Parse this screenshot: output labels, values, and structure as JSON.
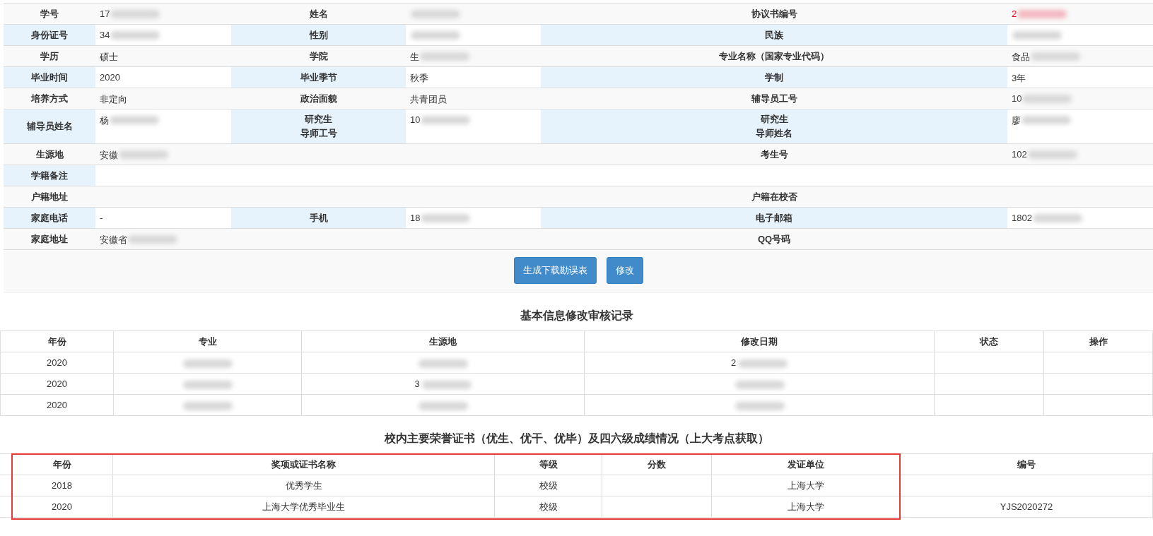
{
  "info_rows": [
    {
      "cells": [
        {
          "kind": "label",
          "text": "学号"
        },
        {
          "kind": "value",
          "text": "17",
          "blurred": true
        },
        {
          "kind": "label",
          "text": "姓名"
        },
        {
          "kind": "value",
          "blurred": true
        },
        {
          "kind": "label",
          "text": "协议书编号"
        },
        {
          "kind": "value",
          "text": "2",
          "blurred": true,
          "warning": true
        }
      ]
    },
    {
      "cells": [
        {
          "kind": "label",
          "text": "身份证号"
        },
        {
          "kind": "value",
          "text": "34",
          "blurred": true
        },
        {
          "kind": "label",
          "text": "性别"
        },
        {
          "kind": "value",
          "blurred": true
        },
        {
          "kind": "label",
          "text": "民族"
        },
        {
          "kind": "value",
          "blurred": true
        }
      ]
    },
    {
      "cells": [
        {
          "kind": "label",
          "text": "学历"
        },
        {
          "kind": "value",
          "text": "硕士"
        },
        {
          "kind": "label",
          "text": "学院"
        },
        {
          "kind": "value",
          "text": "生",
          "blurred": true
        },
        {
          "kind": "label",
          "text": "专业名称（国家专业代码）"
        },
        {
          "kind": "value",
          "text": "食品",
          "blurred": true
        }
      ]
    },
    {
      "cells": [
        {
          "kind": "label",
          "text": "毕业时间"
        },
        {
          "kind": "value",
          "text": "2020"
        },
        {
          "kind": "label",
          "text": "毕业季节"
        },
        {
          "kind": "value",
          "text": "秋季"
        },
        {
          "kind": "label",
          "text": "学制"
        },
        {
          "kind": "value",
          "text": "3年"
        }
      ]
    },
    {
      "cells": [
        {
          "kind": "label",
          "text": "培养方式"
        },
        {
          "kind": "value",
          "text": "非定向"
        },
        {
          "kind": "label",
          "text": "政治面貌"
        },
        {
          "kind": "value",
          "text": "共青团员"
        },
        {
          "kind": "label",
          "text": "辅导员工号"
        },
        {
          "kind": "value",
          "text": "10",
          "blurred": true
        }
      ]
    },
    {
      "cells": [
        {
          "kind": "label",
          "text": "辅导员姓名"
        },
        {
          "kind": "value",
          "text": "杨",
          "blurred": true
        },
        {
          "kind": "label",
          "lines": [
            "研究生",
            "导师工号"
          ]
        },
        {
          "kind": "value",
          "text": "10",
          "blurred": true
        },
        {
          "kind": "label",
          "lines": [
            "研究生",
            "导师姓名"
          ]
        },
        {
          "kind": "value",
          "text": "廖",
          "blurred": true
        }
      ]
    },
    {
      "cells": [
        {
          "kind": "label",
          "text": "生源地"
        },
        {
          "kind": "value",
          "text": "安徽",
          "blurred": true
        },
        {
          "kind": "blank"
        },
        {
          "kind": "blank"
        },
        {
          "kind": "label",
          "text": "考生号"
        },
        {
          "kind": "value",
          "text": "102",
          "blurred": true
        }
      ]
    },
    {
      "cells": [
        {
          "kind": "label",
          "text": "学籍备注"
        },
        {
          "kind": "blank"
        },
        {
          "kind": "blank"
        },
        {
          "kind": "blank"
        },
        {
          "kind": "blank"
        },
        {
          "kind": "blank"
        }
      ]
    },
    {
      "cells": [
        {
          "kind": "label",
          "text": "户籍地址"
        },
        {
          "kind": "blank"
        },
        {
          "kind": "blank"
        },
        {
          "kind": "blank"
        },
        {
          "kind": "label",
          "text": "户籍在校否"
        },
        {
          "kind": "blank"
        }
      ]
    },
    {
      "cells": [
        {
          "kind": "label",
          "text": "家庭电话"
        },
        {
          "kind": "value",
          "text": "-"
        },
        {
          "kind": "label",
          "text": "手机"
        },
        {
          "kind": "value",
          "text": "18",
          "blurred": true
        },
        {
          "kind": "label",
          "text": "电子邮箱"
        },
        {
          "kind": "value",
          "text": "1802",
          "blurred": true
        }
      ]
    },
    {
      "cells": [
        {
          "kind": "label",
          "text": "家庭地址"
        },
        {
          "kind": "value",
          "text": "安徽省",
          "blurred": true
        },
        {
          "kind": "blank"
        },
        {
          "kind": "blank"
        },
        {
          "kind": "label",
          "text": "QQ号码"
        },
        {
          "kind": "blank"
        }
      ]
    }
  ],
  "buttons": [
    "生成下载勘误表",
    "修改"
  ],
  "audit": {
    "title": "基本信息修改审核记录",
    "columns": [
      "年份",
      "专业",
      "生源地",
      "修改日期",
      "状态",
      "操作"
    ],
    "rows": [
      [
        {
          "text": "2020"
        },
        {
          "blurred": true
        },
        {
          "blurred": true
        },
        {
          "text": "2",
          "blurred": true
        },
        {},
        {}
      ],
      [
        {
          "text": "2020"
        },
        {
          "blurred": true
        },
        {
          "text": "3",
          "blurred": true
        },
        {
          "blurred": true
        },
        {},
        {}
      ],
      [
        {
          "text": "2020"
        },
        {
          "blurred": true
        },
        {
          "blurred": true
        },
        {
          "blurred": true
        },
        {},
        {}
      ]
    ]
  },
  "honors": {
    "title": "校内主要荣誉证书（优生、优干、优毕）及四六级成绩情况（上大考点获取）",
    "columns": [
      "年份",
      "奖项或证书名称",
      "等级",
      "分数",
      "发证单位",
      "编号"
    ],
    "rows": [
      [
        "2018",
        "优秀学生",
        "校级",
        null,
        "上海大学",
        null
      ],
      [
        "2020",
        "上海大学优秀毕业生",
        "校级",
        null,
        "上海大学",
        "YJS2020272"
      ]
    ],
    "highlighted": true
  }
}
